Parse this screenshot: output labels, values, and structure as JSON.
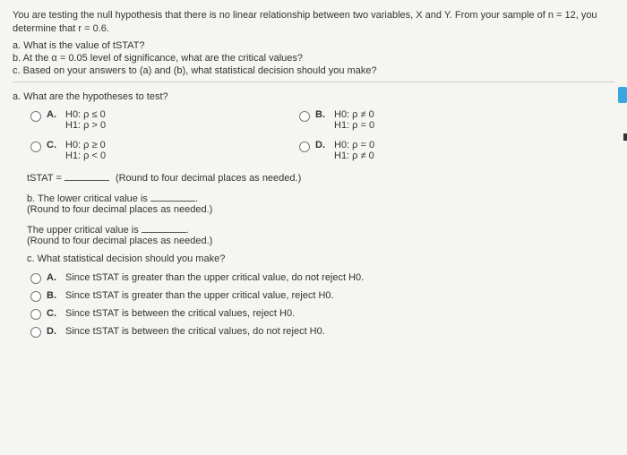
{
  "intro": {
    "line1": "You are testing the null hypothesis that there is no linear relationship between two variables, X and Y. From your sample of n = 12, you determine that r = 0.6.",
    "qa": "a. What is the value of tSTAT?",
    "qb": "b. At the α = 0.05 level of significance, what are the critical values?",
    "qc": "c. Based on your answers to (a) and (b), what statistical decision should you make?"
  },
  "sectionA": {
    "prompt": "a. What are the hypotheses to test?",
    "choices": {
      "A": {
        "label": "A.",
        "h0": "H0: ρ ≤ 0",
        "h1": "H1: ρ > 0"
      },
      "B": {
        "label": "B.",
        "h0": "H0: ρ ≠ 0",
        "h1": "H1: ρ = 0"
      },
      "C": {
        "label": "C.",
        "h0": "H0: ρ ≥ 0",
        "h1": "H1: ρ < 0"
      },
      "D": {
        "label": "D.",
        "h0": "H0: ρ = 0",
        "h1": "H1: ρ ≠ 0"
      }
    }
  },
  "tstat": {
    "label": "tSTAT =",
    "note": "(Round to four decimal places as needed.)"
  },
  "sectionB": {
    "lower": "b. The lower critical value is",
    "lowerNote": "(Round to four decimal places as needed.)",
    "upper": "The upper critical value is",
    "upperNote": "(Round to four decimal places as needed.)"
  },
  "sectionC": {
    "prompt": "c. What statistical decision should you make?",
    "choices": {
      "A": {
        "label": "A.",
        "text": "Since tSTAT is greater than the upper critical value, do not reject H0."
      },
      "B": {
        "label": "B.",
        "text": "Since tSTAT is greater than the upper critical value, reject H0."
      },
      "C": {
        "label": "C.",
        "text": "Since tSTAT is between the critical values, reject H0."
      },
      "D": {
        "label": "D.",
        "text": "Since tSTAT is between the critical values, do not reject H0."
      }
    }
  }
}
